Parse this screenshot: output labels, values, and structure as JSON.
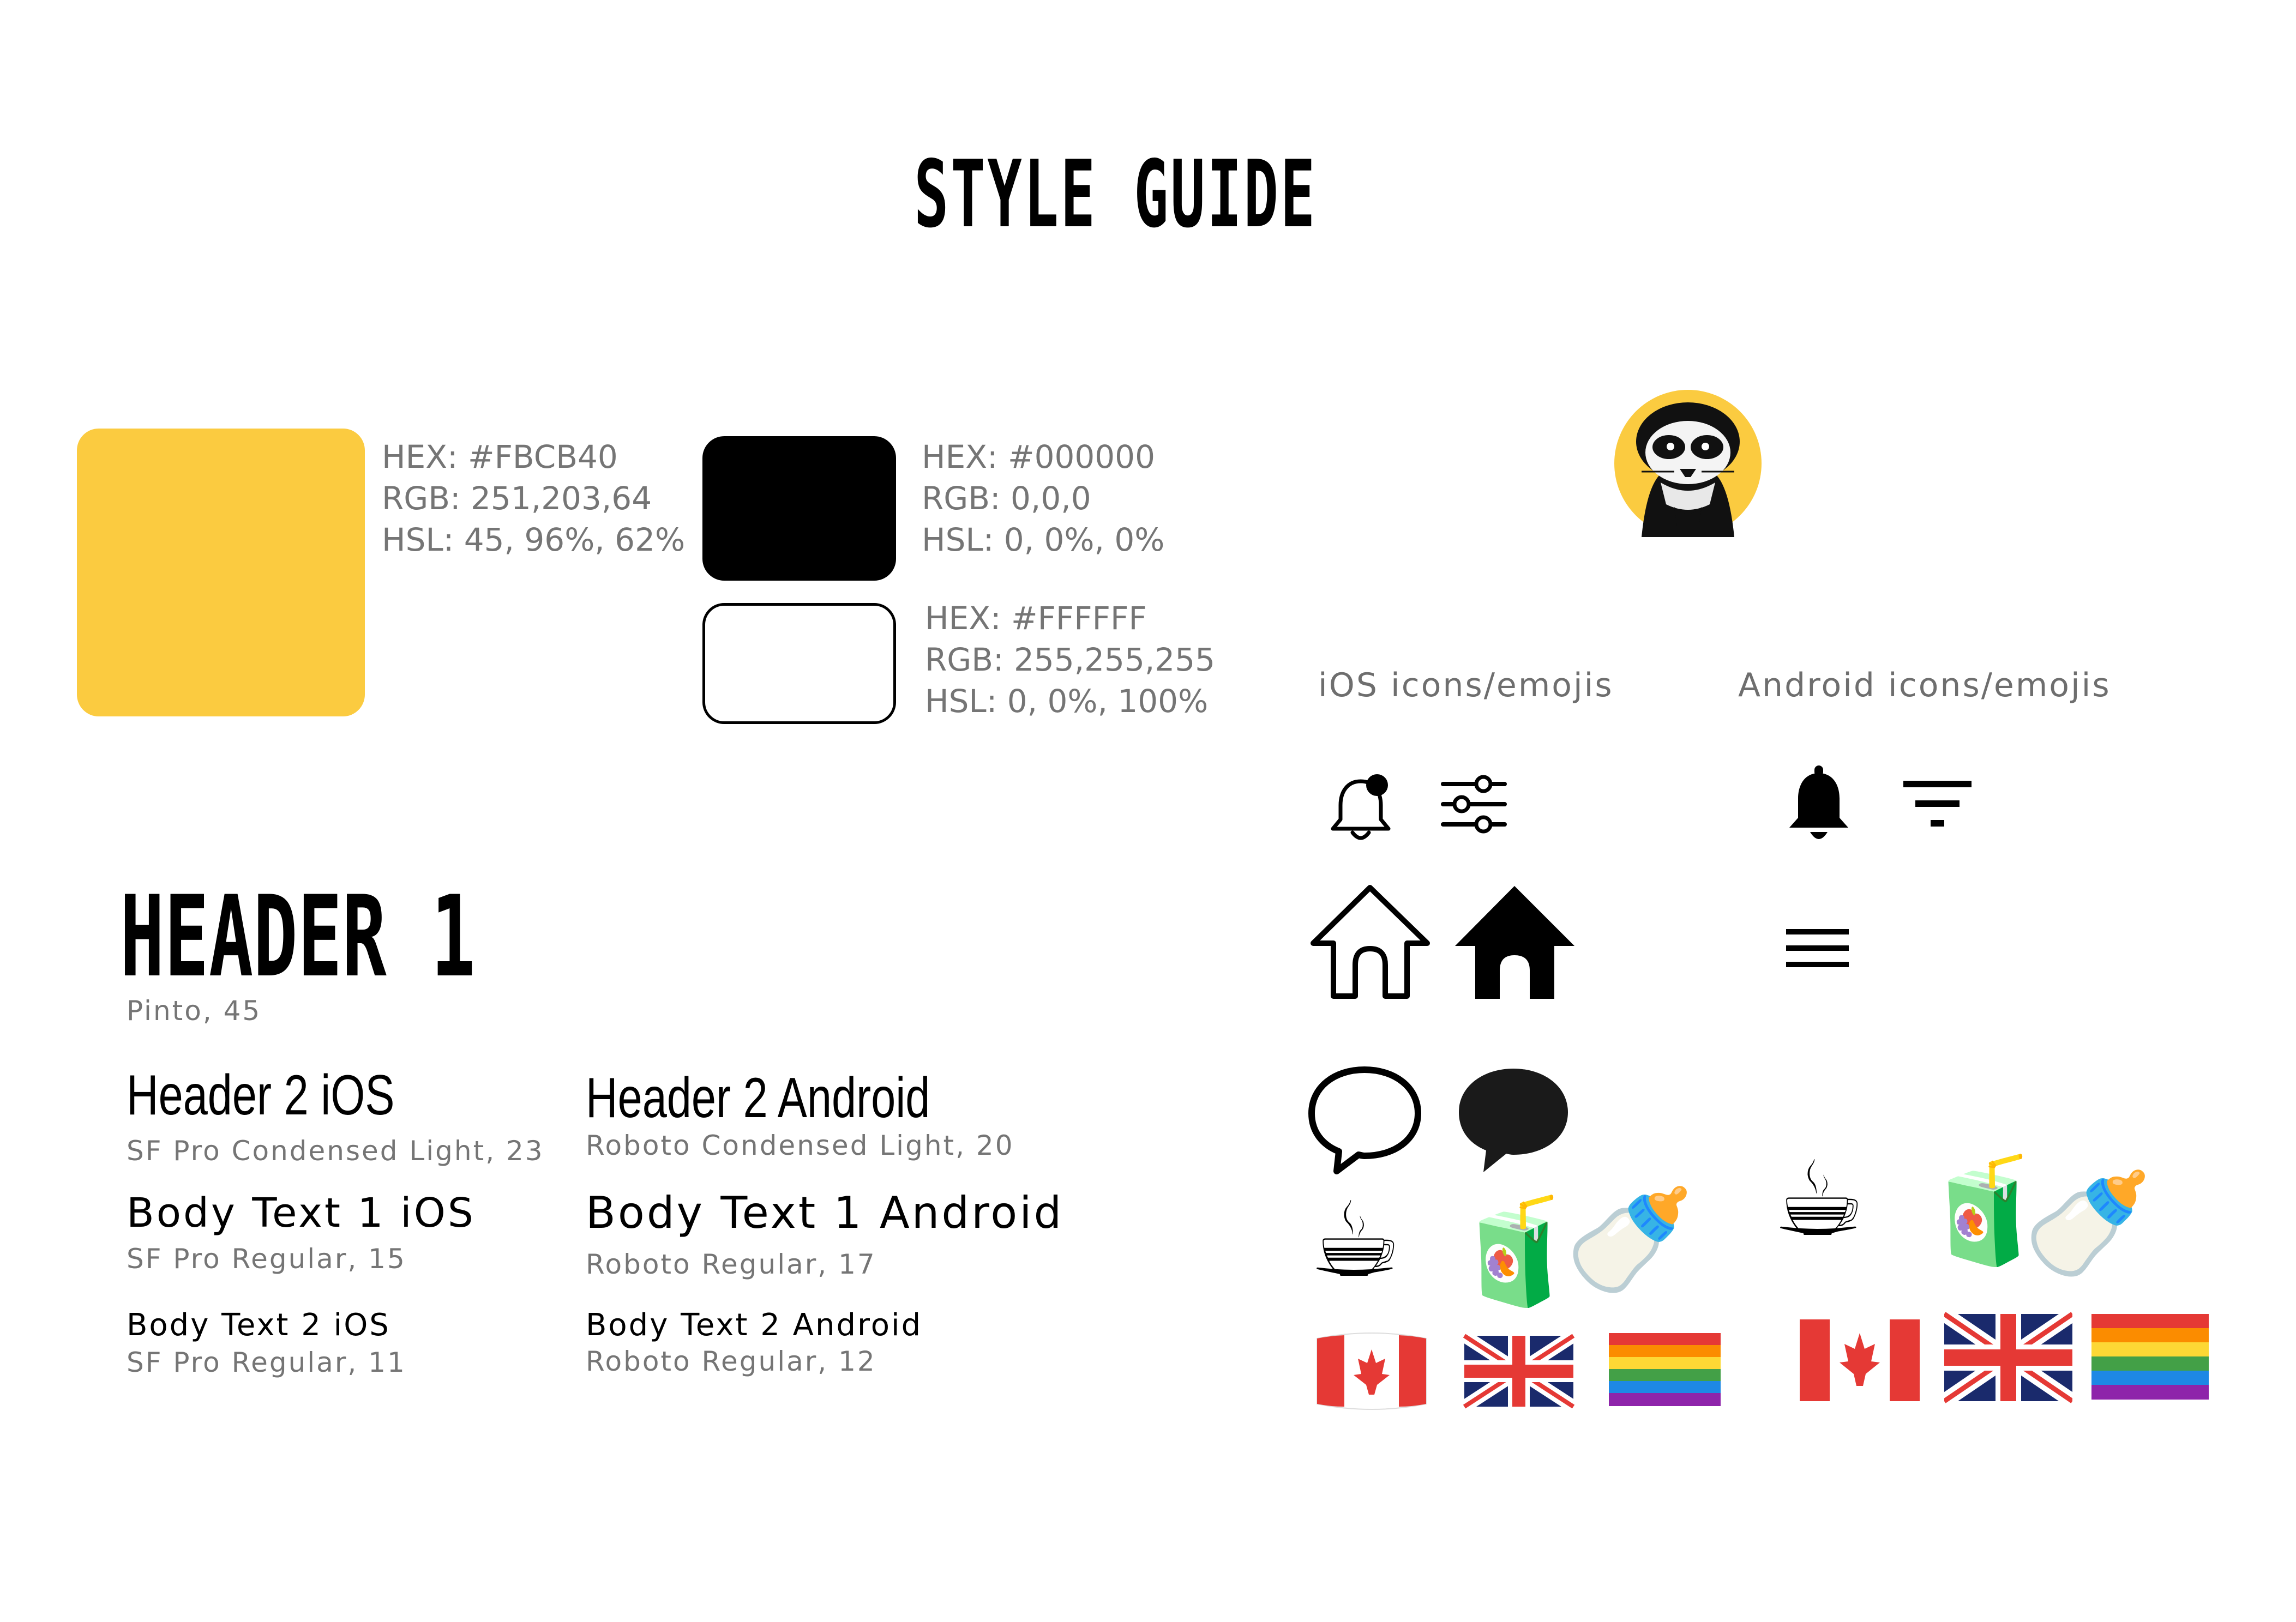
{
  "title": "STYLE GUIDE",
  "colors": [
    {
      "hex": "HEX: #FBCB40",
      "rgb": "RGB: 251,203,64",
      "hsl": "HSL: 45, 96%, 62%",
      "swatch": "#FBCB40"
    },
    {
      "hex": "HEX: #000000",
      "rgb": "RGB: 0,0,0",
      "hsl": "HSL: 0, 0%, 0%",
      "swatch": "#000000"
    },
    {
      "hex": "HEX: #FFFFFF",
      "rgb": "RGB: 255,255,255",
      "hsl": "HSL: 0, 0%, 100%",
      "swatch": "#FFFFFF"
    }
  ],
  "typography": {
    "header1": {
      "sample": "HEADER 1",
      "spec": "Pinto, 45"
    },
    "ios": {
      "header2": {
        "sample": "Header 2 iOS",
        "spec": "SF Pro Condensed Light, 23"
      },
      "body1": {
        "sample": "Body Text 1 iOS",
        "spec": "SF Pro Regular, 15"
      },
      "body2": {
        "sample": "Body Text 2 iOS",
        "spec": "SF Pro Regular, 11"
      }
    },
    "android": {
      "header2": {
        "sample": "Header 2 Android",
        "spec": "Roboto Condensed Light, 20"
      },
      "body1": {
        "sample": "Body Text 1 Android",
        "spec": "Roboto Regular, 17"
      },
      "body2": {
        "sample": "Body Text 2 Android",
        "spec": "Roboto Regular, 12"
      }
    }
  },
  "icons": {
    "ios_label": "iOS icons/emojis",
    "android_label": "Android icons/emojis",
    "ios": [
      "bell-badge-icon",
      "sliders-icon",
      "home-outline-icon",
      "home-filled-icon",
      "speech-bubble-outline-icon",
      "speech-bubble-filled-icon"
    ],
    "android": [
      "bell-filled-icon",
      "filter-icon",
      "menu-icon"
    ],
    "emojis": {
      "coffee": "☕",
      "juice_box": "🧃",
      "baby_bottle": "🍼",
      "flag_canada": "🇨🇦",
      "flag_uk": "🇬🇧",
      "flag_rainbow": "🏳️‍🌈"
    }
  },
  "logo": "meerkat-logo"
}
